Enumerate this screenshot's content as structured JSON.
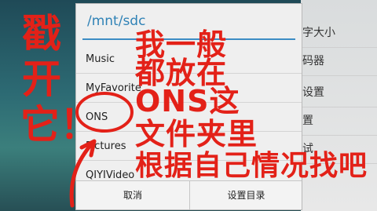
{
  "background_panel": {
    "items": [
      "字大小",
      "码器",
      "设置",
      "置",
      "试",
      ""
    ]
  },
  "dialog": {
    "path": "/mnt/sdc",
    "rows": [
      "Music",
      "MyFavorite",
      "ONS",
      "Pictures",
      "QIYIVideo"
    ],
    "cancel_label": "取消",
    "set_dir_label": "设置目录"
  },
  "annotation": {
    "side_text": "戳开它！",
    "lines": [
      "我一般",
      "都放在",
      "ONS这",
      "文件夹里",
      "根据自己情况找吧"
    ],
    "color": "#e32118"
  }
}
